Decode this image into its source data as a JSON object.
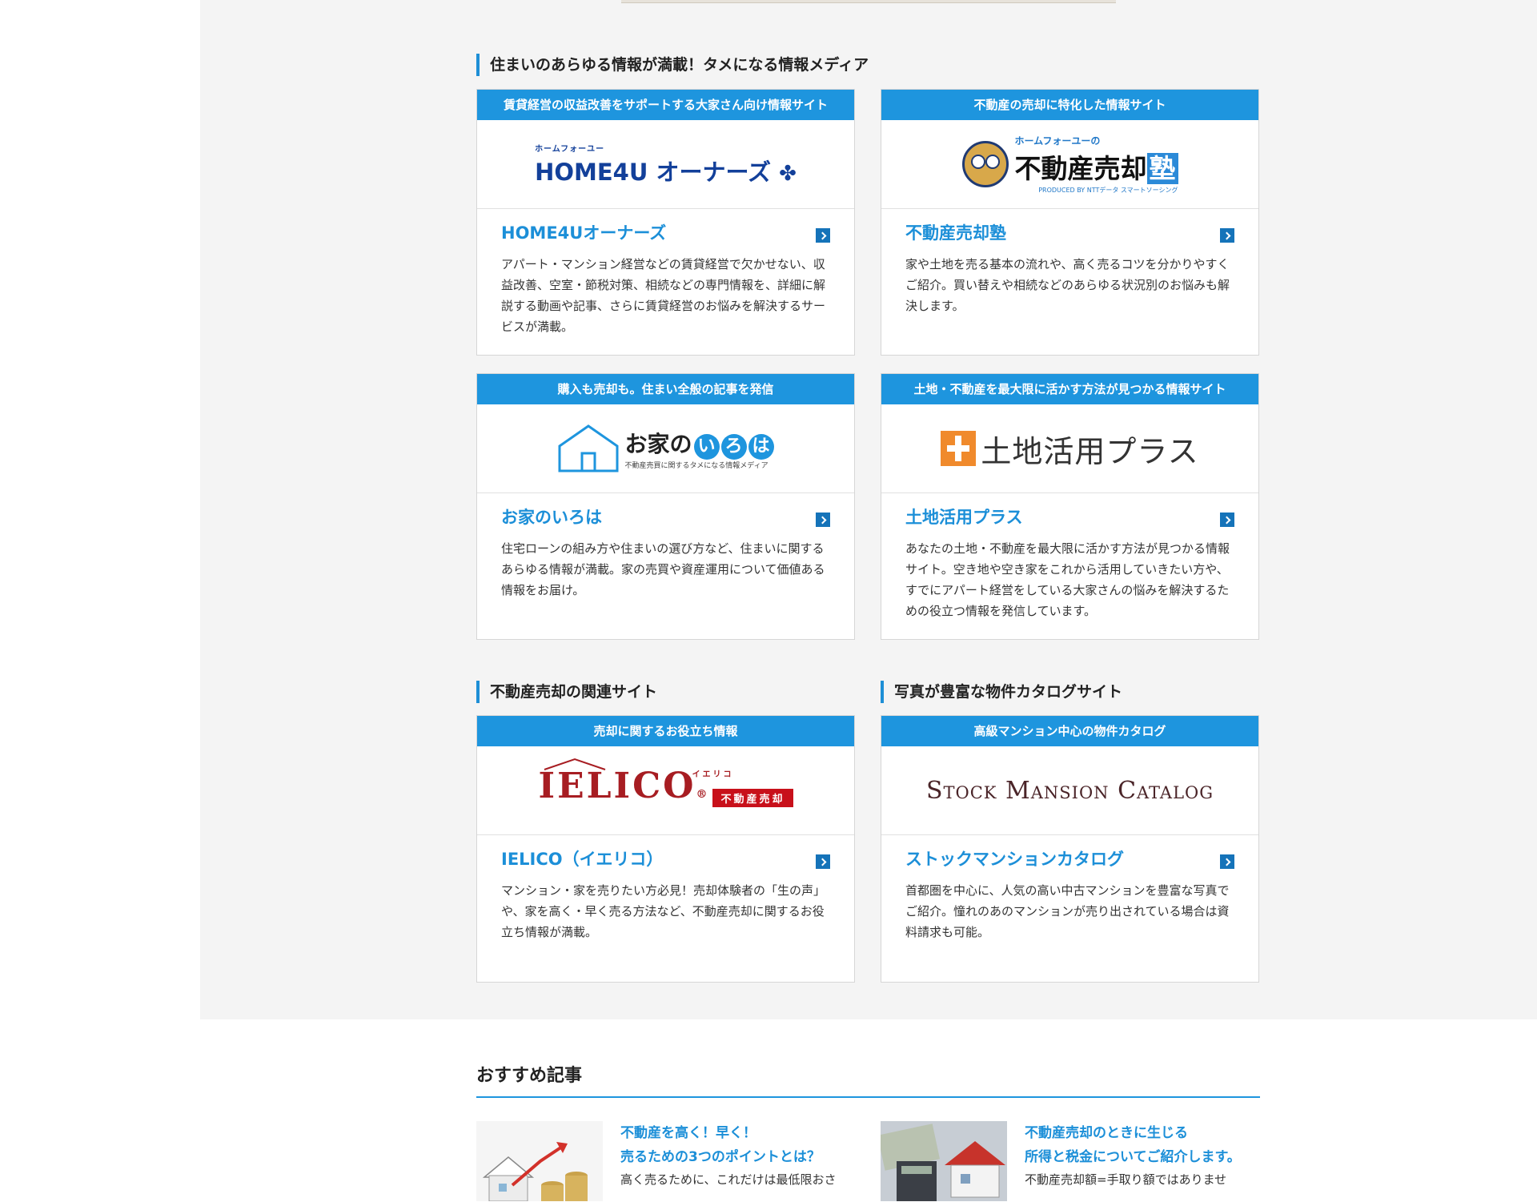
{
  "media_section": {
    "heading": "住まいのあらゆる情報が満載！タメになる情報メディア",
    "cards": [
      {
        "header": "賃貸経営の収益改善をサポートする大家さん向け情報サイト",
        "logo_small": "ホームフォーユー",
        "logo_main": "HOME4U オーナーズ",
        "logo_mark": "✤",
        "title": "HOME4Uオーナーズ",
        "desc": "アパート・マンション経営などの賃貸経営で欠かせない、収益改善、空室・節税対策、相続などの専門情報を、詳細に解説する動画や記事、さらに賃貸経営のお悩みを解決するサービスが満載。"
      },
      {
        "header": "不動産の売却に特化した情報サイト",
        "logo_top": "ホームフォーユーの",
        "logo_main": "不動産売却",
        "logo_box": "塾",
        "logo_sub": "PRODUCED BY NTTデータ スマートソーシング",
        "title": "不動産売却塾",
        "desc": "家や土地を売る基本の流れや、高く売るコツを分かりやすくご紹介。買い替えや相続などのあらゆる状況別のお悩みも解決します。"
      },
      {
        "header": "購入も売却も。住まい全般の記事を発信",
        "logo_main": "お家の",
        "logo_chars": [
          "い",
          "ろ",
          "は"
        ],
        "logo_sub": "不動産売買に関するタメになる情報メディア",
        "title": "お家のいろは",
        "desc": "住宅ローンの組み方や住まいの選び方など、住まいに関するあらゆる情報が満載。家の売買や資産運用について価値ある情報をお届け。"
      },
      {
        "header": "土地・不動産を最大限に活かす方法が見つかる情報サイト",
        "logo_main": "土地活用プラス",
        "title": "土地活用プラス",
        "desc": "あなたの土地・不動産を最大限に活かす方法が見つかる情報サイト。空き地や空き家をこれから活用していきたい方や、すでにアパート経営をしている大家さんの悩みを解決するための役立つ情報を発信しています。"
      }
    ]
  },
  "related_section": {
    "heading": "不動産売却の関連サイト",
    "card": {
      "header": "売却に関するお役立ち情報",
      "logo_main": "IELICO",
      "logo_reg": "®",
      "logo_kana": "イエリコ",
      "logo_badge": "不動産売却",
      "title": "IELICO（イエリコ）",
      "desc": "マンション・家を売りたい方必見！売却体験者の「生の声」や、家を高く・早く売る方法など、不動産売却に関するお役立ち情報が満載。"
    }
  },
  "catalog_section": {
    "heading": "写真が豊富な物件カタログサイト",
    "card": {
      "header": "高級マンション中心の物件カタログ",
      "logo_main": "Stock Mansion Catalog",
      "title": "ストックマンションカタログ",
      "desc": "首都圏を中心に、人気の高い中古マンションを豊富な写真でご紹介。憧れのあのマンションが売り出されている場合は資料請求も可能。"
    }
  },
  "recommended": {
    "title": "おすすめ記事",
    "items": [
      {
        "head1": "不動産を高く！早く！",
        "head2": "売るための3つのポイントとは？",
        "snippet": "高く売るために、これだけは最低限おさ",
        "image": "house-coins-graph-image"
      },
      {
        "head1": "不動産売却のときに生じる",
        "head2": "所得と税金についてご紹介します。",
        "snippet": "不動産売却額=手取り額ではありませ",
        "image": "house-money-calculator-image"
      }
    ]
  },
  "colors": {
    "accent": "#1e95de",
    "title_blue": "#1c8fd8",
    "arrow_blue": "#1573b9",
    "background_gray": "#f4f4f4"
  }
}
